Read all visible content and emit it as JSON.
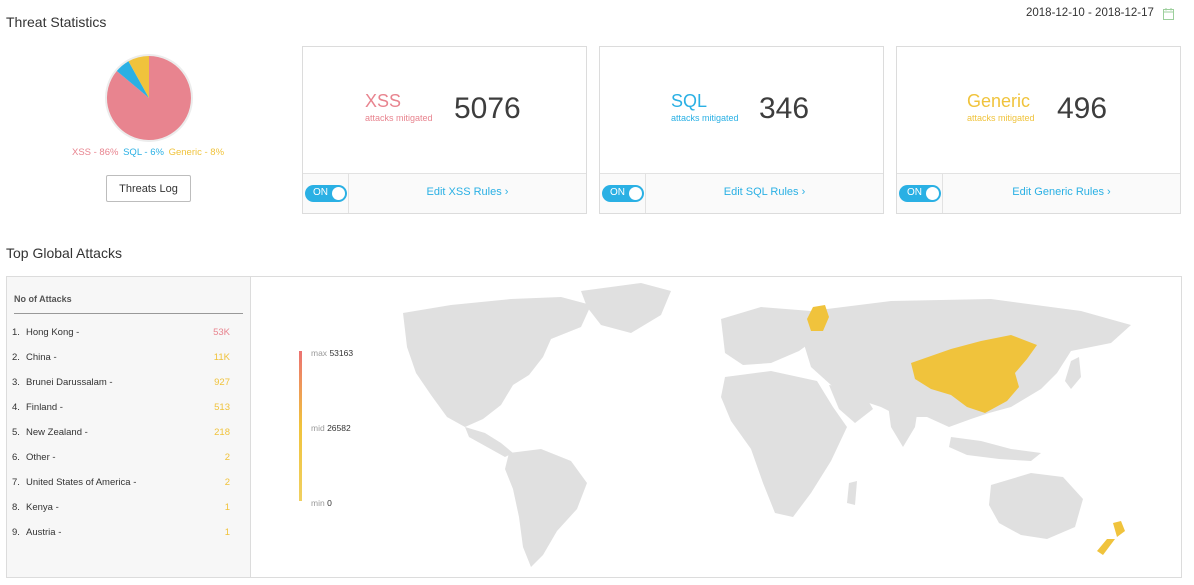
{
  "header": {
    "threat_title": "Threat Statistics",
    "date_range": "2018-12-10 - 2018-12-17",
    "calendar_icon": "calendar-icon"
  },
  "pie": {
    "legend": [
      {
        "label": "XSS - 86%",
        "color": "#e8848f"
      },
      {
        "label": "SQL - 6%",
        "color": "#2ab0e4"
      },
      {
        "label": "Generic - 8%",
        "color": "#f0c33c"
      }
    ]
  },
  "threats_log_button": "Threats Log",
  "cards": [
    {
      "type": "XSS",
      "sub": "attacks mitigated",
      "count": "5076",
      "color": "#e8848f",
      "toggle": "ON",
      "edit": "Edit XSS Rules ›"
    },
    {
      "type": "SQL",
      "sub": "attacks mitigated",
      "count": "346",
      "color": "#2ab0e4",
      "toggle": "ON",
      "edit": "Edit SQL Rules ›"
    },
    {
      "type": "Generic",
      "sub": "attacks mitigated",
      "count": "496",
      "color": "#f0c33c",
      "toggle": "ON",
      "edit": "Edit Generic Rules ›"
    }
  ],
  "global": {
    "title": "Top Global Attacks",
    "list_header": "No of Attacks",
    "rows": [
      {
        "rank": "1.",
        "country": "Hong Kong -",
        "value": "53K",
        "color": "#e8848f"
      },
      {
        "rank": "2.",
        "country": "China -",
        "value": "11K",
        "color": "#f0c33c"
      },
      {
        "rank": "3.",
        "country": "Brunei Darussalam -",
        "value": "927",
        "color": "#f0c33c"
      },
      {
        "rank": "4.",
        "country": "Finland -",
        "value": "513",
        "color": "#f0c33c"
      },
      {
        "rank": "5.",
        "country": "New Zealand -",
        "value": "218",
        "color": "#f0c33c"
      },
      {
        "rank": "6.",
        "country": "Other -",
        "value": "2",
        "color": "#f0c33c"
      },
      {
        "rank": "7.",
        "country": "United States of America -",
        "value": "2",
        "color": "#f0c33c"
      },
      {
        "rank": "8.",
        "country": "Kenya -",
        "value": "1",
        "color": "#f0c33c"
      },
      {
        "rank": "9.",
        "country": "Austria -",
        "value": "1",
        "color": "#f0c33c"
      }
    ],
    "scale": {
      "max_label": "max",
      "max_value": "53163",
      "mid_label": "mid",
      "mid_value": "26582",
      "min_label": "min",
      "min_value": "0"
    }
  }
}
